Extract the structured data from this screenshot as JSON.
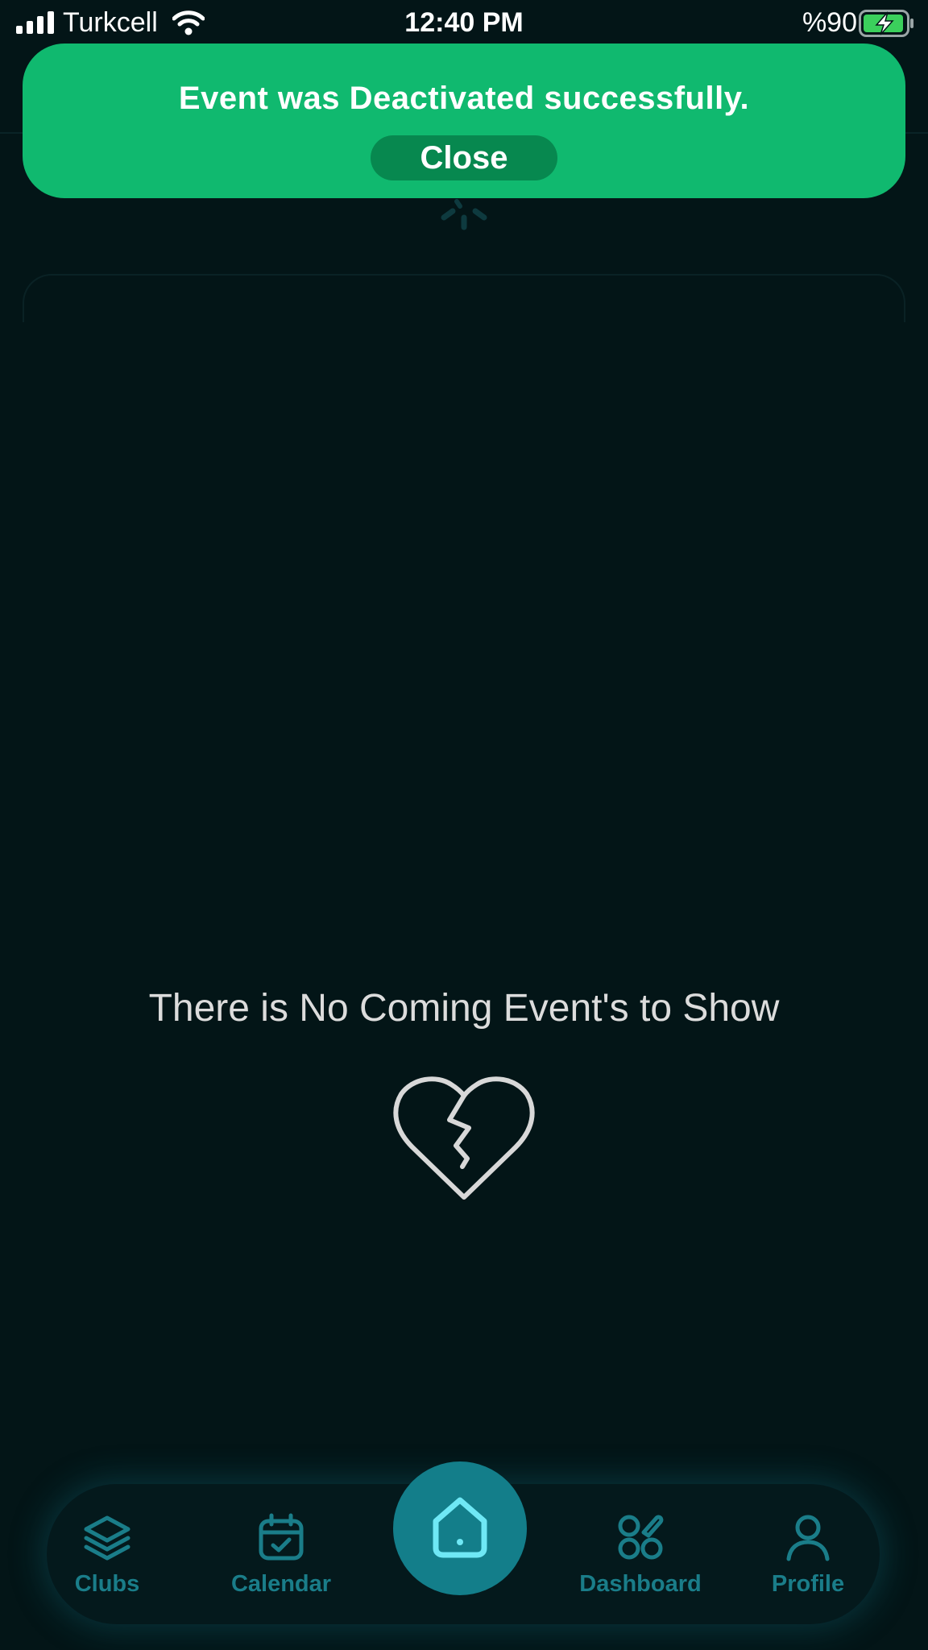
{
  "status_bar": {
    "carrier": "Turkcell",
    "time": "12:40 PM",
    "battery_percent": "%90",
    "signal_icon": "cellular-signal-icon",
    "wifi_icon": "wifi-icon",
    "battery_icon": "battery-charging-icon"
  },
  "toast": {
    "message": "Event was Deactivated successfully.",
    "close_label": "Close",
    "color": "#10b96f",
    "button_color": "#07884f"
  },
  "empty_state": {
    "message": "There is No Coming Event's to Show",
    "icon": "broken-heart-icon"
  },
  "nav": {
    "accent_color": "#1a7d89",
    "items": [
      {
        "label": "Clubs",
        "icon": "layers-icon"
      },
      {
        "label": "Calendar",
        "icon": "calendar-check-icon"
      },
      {
        "label": "",
        "icon": "home-icon"
      },
      {
        "label": "Dashboard",
        "icon": "dashboard-icon"
      },
      {
        "label": "Profile",
        "icon": "user-icon"
      }
    ]
  },
  "colors": {
    "background": "#031517",
    "home_button": "#137e8a"
  }
}
